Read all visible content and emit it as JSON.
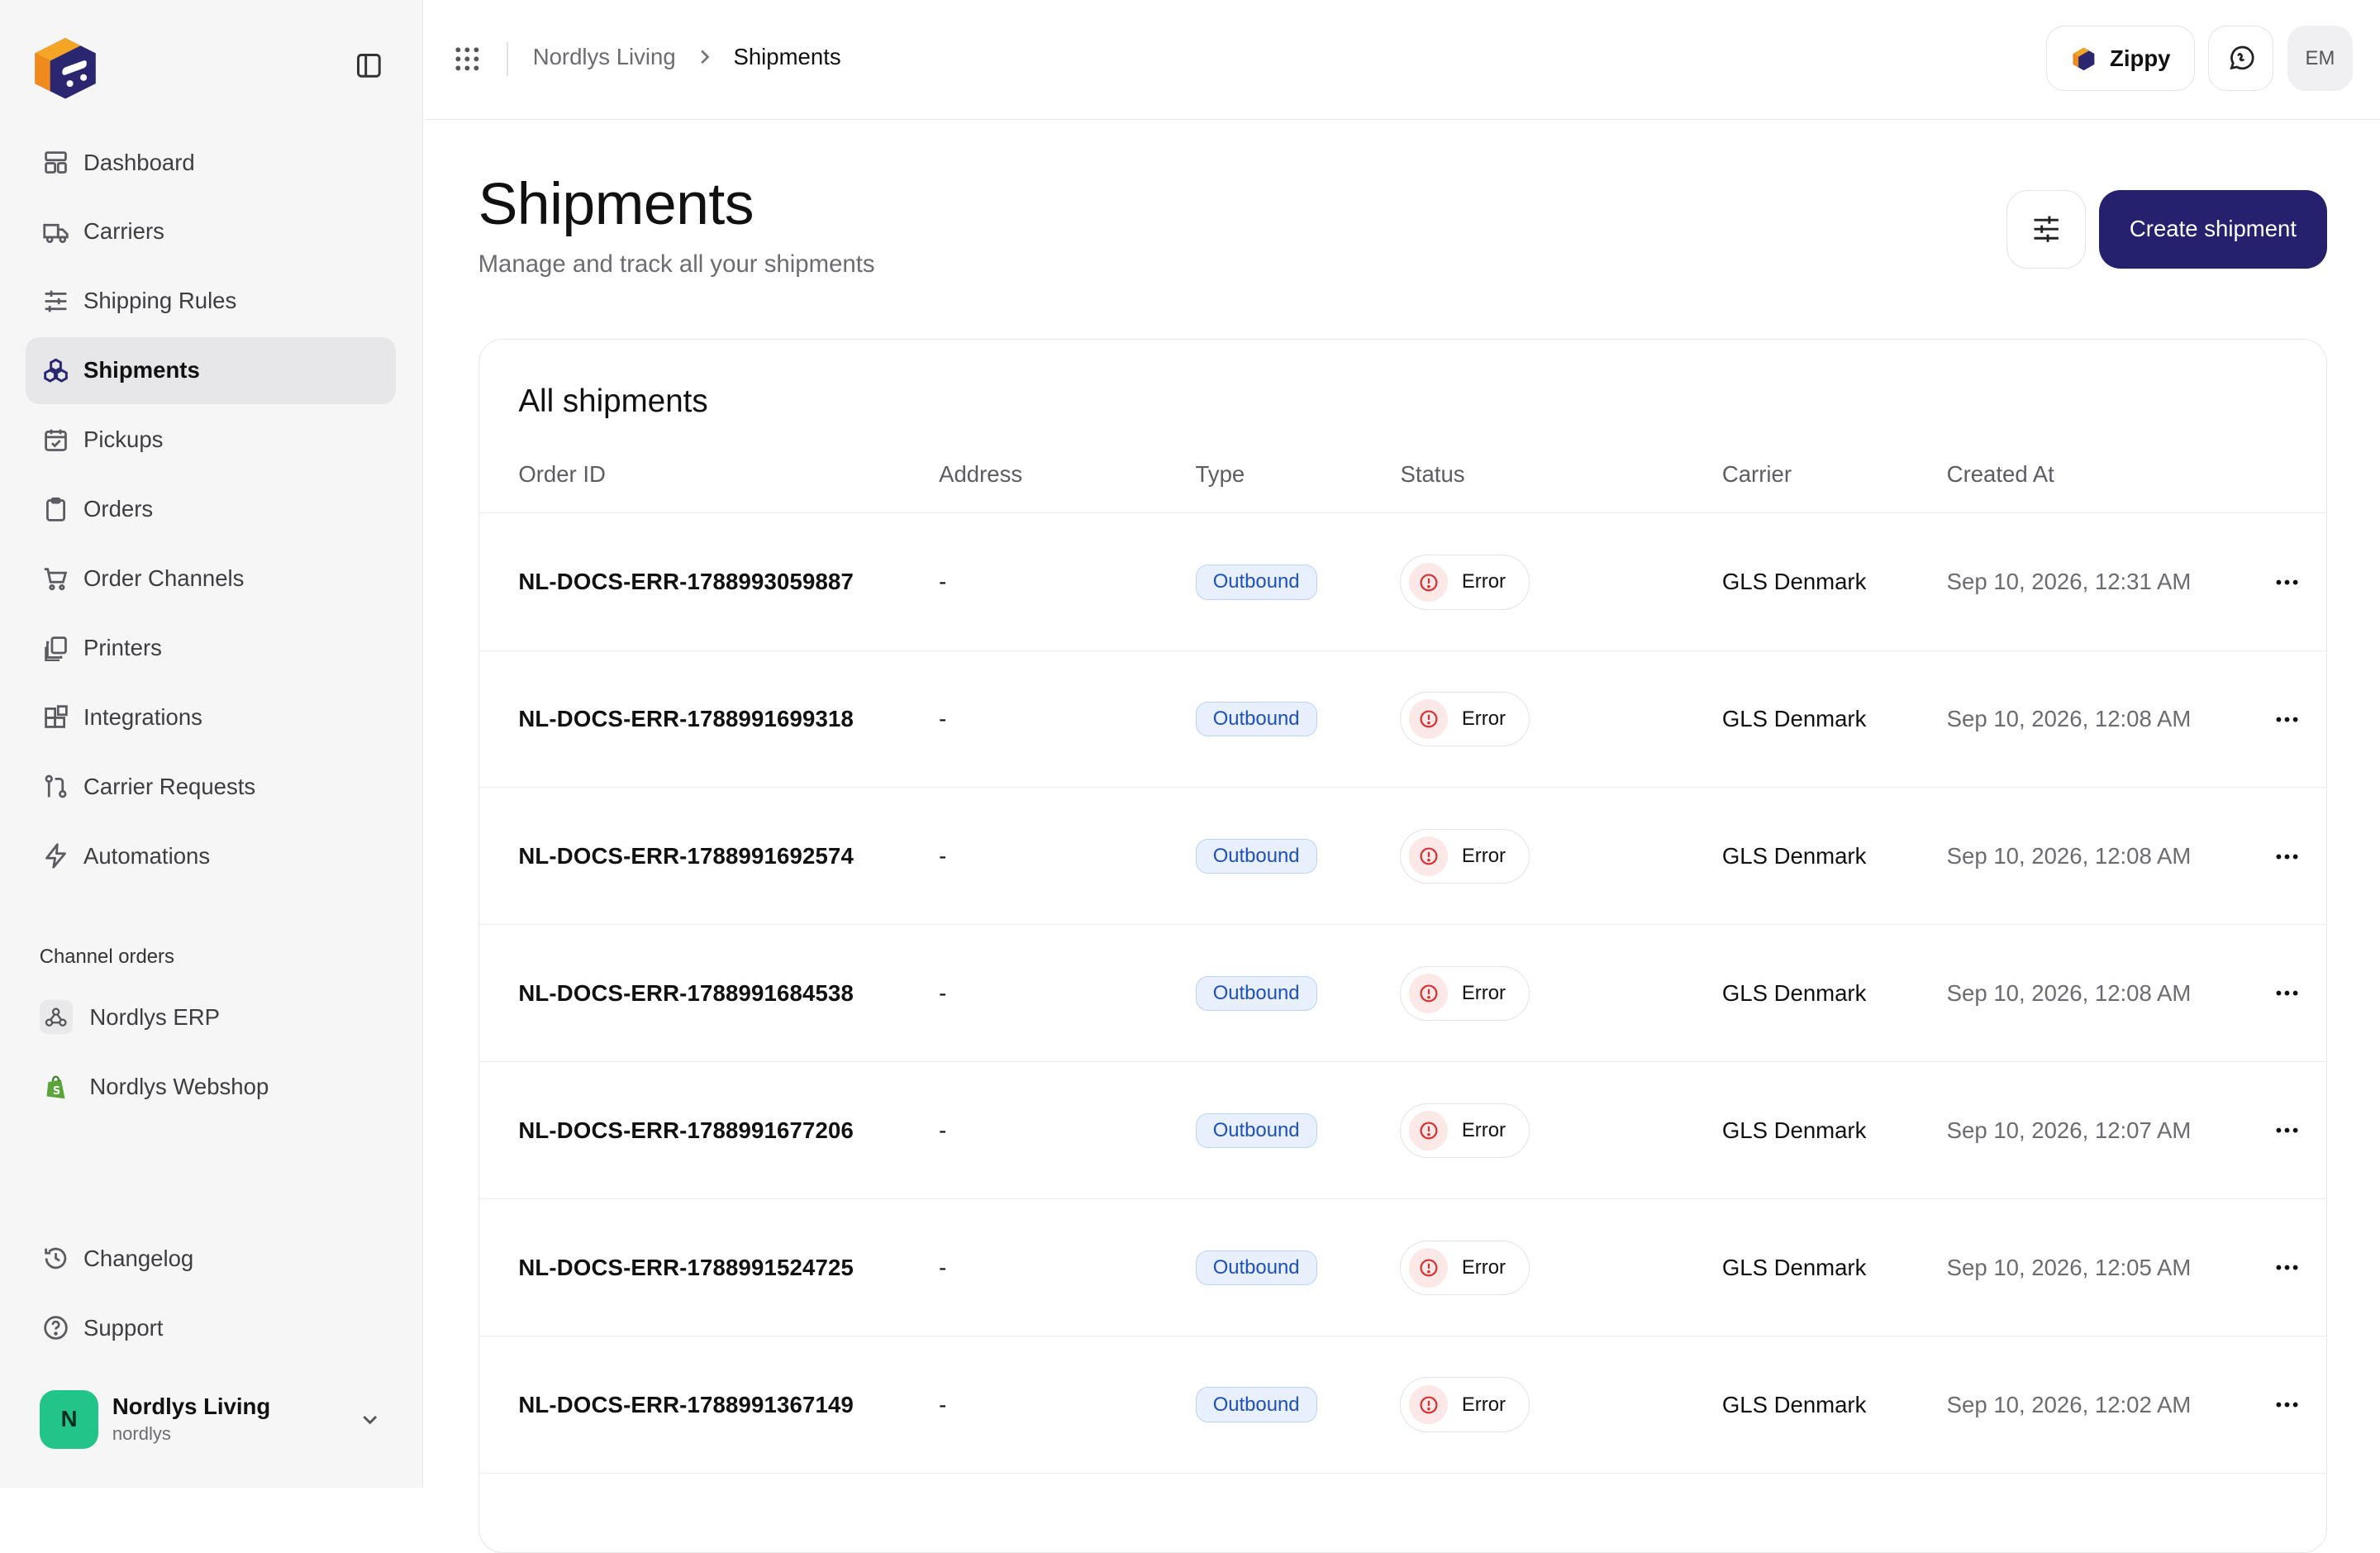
{
  "breadcrumb": {
    "org": "Nordlys Living",
    "current": "Shipments"
  },
  "topbar": {
    "zippy_label": "Zippy",
    "user_initials": "EM"
  },
  "sidebar": {
    "items": [
      {
        "label": "Dashboard",
        "icon": "dashboard-icon"
      },
      {
        "label": "Carriers",
        "icon": "truck-icon"
      },
      {
        "label": "Shipping Rules",
        "icon": "sliders-icon"
      },
      {
        "label": "Shipments",
        "icon": "boxes-icon",
        "active": true
      },
      {
        "label": "Pickups",
        "icon": "calendar-check-icon"
      },
      {
        "label": "Orders",
        "icon": "clipboard-icon"
      },
      {
        "label": "Order Channels",
        "icon": "cart-icon"
      },
      {
        "label": "Printers",
        "icon": "copies-icon"
      },
      {
        "label": "Integrations",
        "icon": "blocks-icon"
      },
      {
        "label": "Carrier Requests",
        "icon": "git-pull-icon"
      },
      {
        "label": "Automations",
        "icon": "bolt-icon"
      }
    ],
    "channel_title": "Channel orders",
    "channels": [
      {
        "label": "Nordlys ERP",
        "icon": "webhook-icon"
      },
      {
        "label": "Nordlys Webshop",
        "icon": "shopify-icon"
      }
    ],
    "bottom": [
      {
        "label": "Changelog",
        "icon": "history-icon"
      },
      {
        "label": "Support",
        "icon": "help-circle-icon"
      }
    ],
    "account": {
      "initial": "N",
      "name": "Nordlys Living",
      "handle": "nordlys"
    }
  },
  "page": {
    "title": "Shipments",
    "subtitle": "Manage and track all your shipments",
    "create_label": "Create shipment"
  },
  "table": {
    "title": "All shipments",
    "columns": [
      "Order ID",
      "Address",
      "Type",
      "Status",
      "Carrier",
      "Created At"
    ],
    "rows": [
      {
        "order_id": "NL-DOCS-ERR-1788993059887",
        "address": "-",
        "type": "Outbound",
        "status": "Error",
        "carrier": "GLS Denmark",
        "created": "Sep 10, 2026, 12:31 AM"
      },
      {
        "order_id": "NL-DOCS-ERR-1788991699318",
        "address": "-",
        "type": "Outbound",
        "status": "Error",
        "carrier": "GLS Denmark",
        "created": "Sep 10, 2026, 12:08 AM"
      },
      {
        "order_id": "NL-DOCS-ERR-1788991692574",
        "address": "-",
        "type": "Outbound",
        "status": "Error",
        "carrier": "GLS Denmark",
        "created": "Sep 10, 2026, 12:08 AM"
      },
      {
        "order_id": "NL-DOCS-ERR-1788991684538",
        "address": "-",
        "type": "Outbound",
        "status": "Error",
        "carrier": "GLS Denmark",
        "created": "Sep 10, 2026, 12:08 AM"
      },
      {
        "order_id": "NL-DOCS-ERR-1788991677206",
        "address": "-",
        "type": "Outbound",
        "status": "Error",
        "carrier": "GLS Denmark",
        "created": "Sep 10, 2026, 12:07 AM"
      },
      {
        "order_id": "NL-DOCS-ERR-1788991524725",
        "address": "-",
        "type": "Outbound",
        "status": "Error",
        "carrier": "GLS Denmark",
        "created": "Sep 10, 2026, 12:05 AM"
      },
      {
        "order_id": "NL-DOCS-ERR-1788991367149",
        "address": "-",
        "type": "Outbound",
        "status": "Error",
        "carrier": "GLS Denmark",
        "created": "Sep 10, 2026, 12:02 AM"
      }
    ]
  },
  "colors": {
    "brand": "#25216e",
    "badge_blue": "#1f4fb8",
    "error_red": "#d93030",
    "avatar_green": "#22c48a"
  }
}
